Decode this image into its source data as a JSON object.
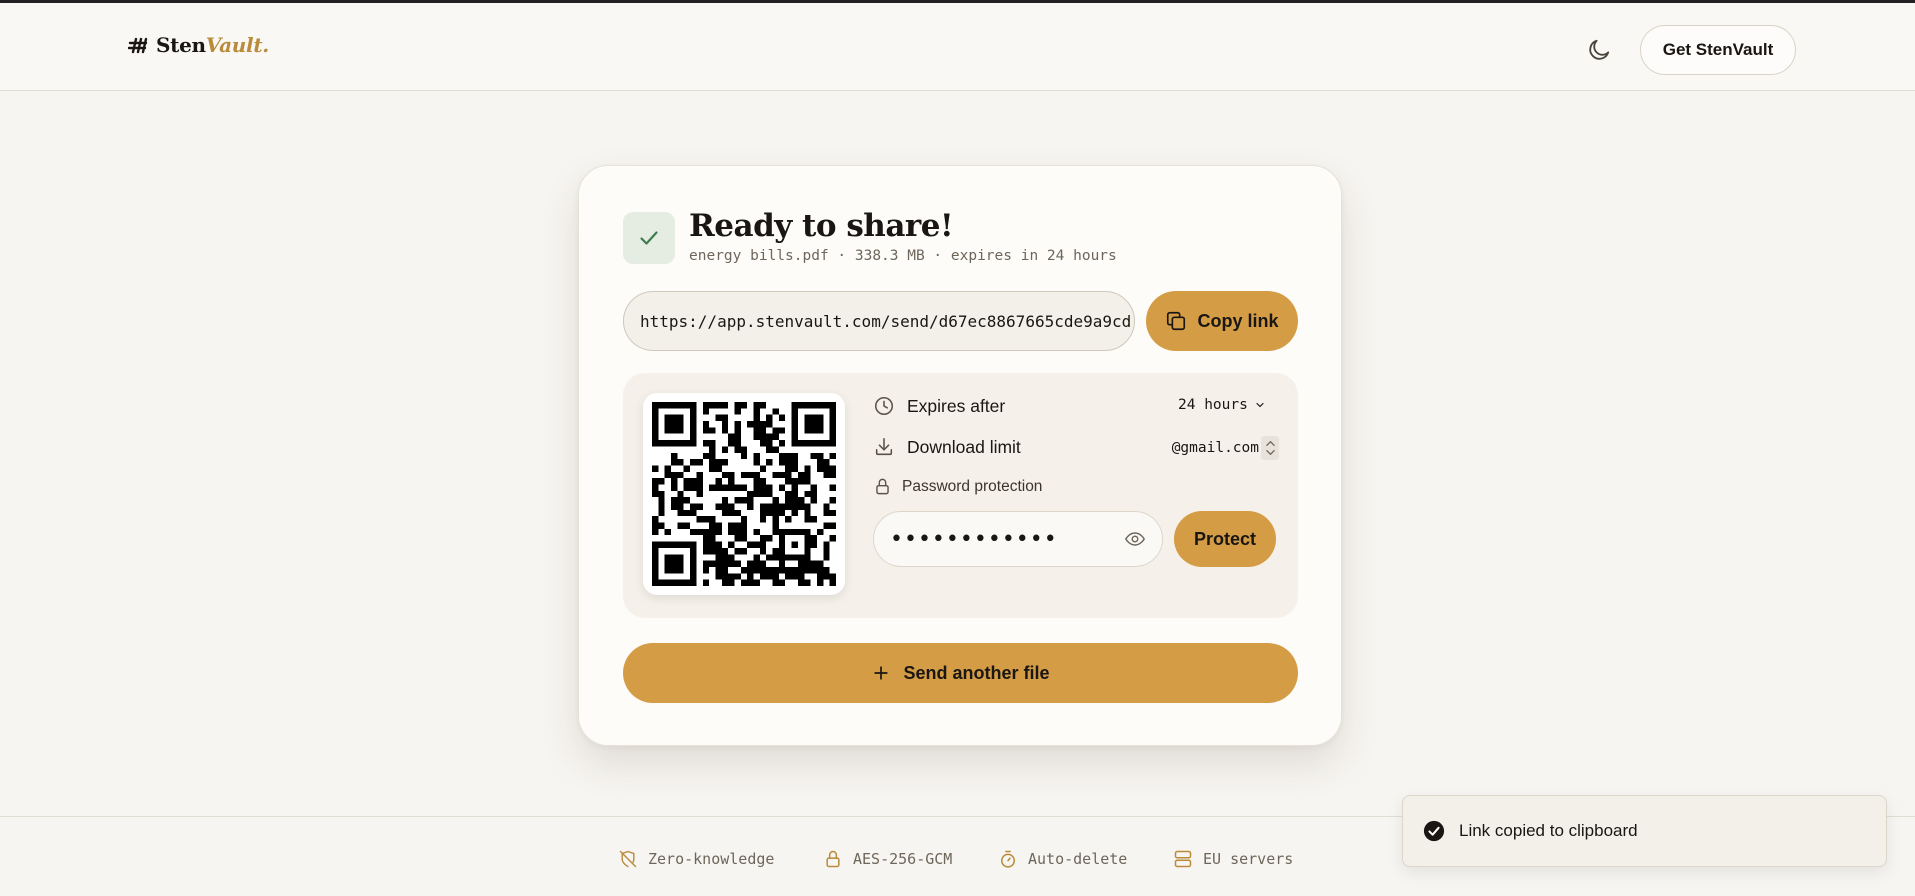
{
  "header": {
    "logo": {
      "name": "Sten",
      "accent": "Vault."
    },
    "cta_label": "Get StenVault",
    "theme_icon": "moon-icon"
  },
  "card": {
    "title": "Ready to share!",
    "meta": "energy bills.pdf · 338.3 MB · expires in 24 hours",
    "share_url": "https://app.stenvault.com/send/d67ec8867665cde9a9cd",
    "copy_label": "Copy link",
    "options": {
      "expires_label": "Expires after",
      "expires_value": "24 hours",
      "download_label": "Download limit",
      "download_value": "@gmail.com",
      "password_label": "Password protection",
      "password_value": "••••••••••••",
      "protect_label": "Protect"
    },
    "send_another_label": "Send another file"
  },
  "footer": {
    "badges": [
      {
        "label": "Zero-knowledge",
        "icon": "shield-off-icon"
      },
      {
        "label": "AES-256-GCM",
        "icon": "lock-icon"
      },
      {
        "label": "Auto-delete",
        "icon": "timer-icon"
      },
      {
        "label": "EU servers",
        "icon": "server-icon"
      }
    ]
  },
  "toast": {
    "message": "Link copied to clipboard"
  },
  "colors": {
    "accent": "#d49c45",
    "logo_accent": "#b98b3b",
    "background": "#f7f5f1",
    "success_bg": "#e5ece1",
    "success": "#3f7d4f"
  }
}
